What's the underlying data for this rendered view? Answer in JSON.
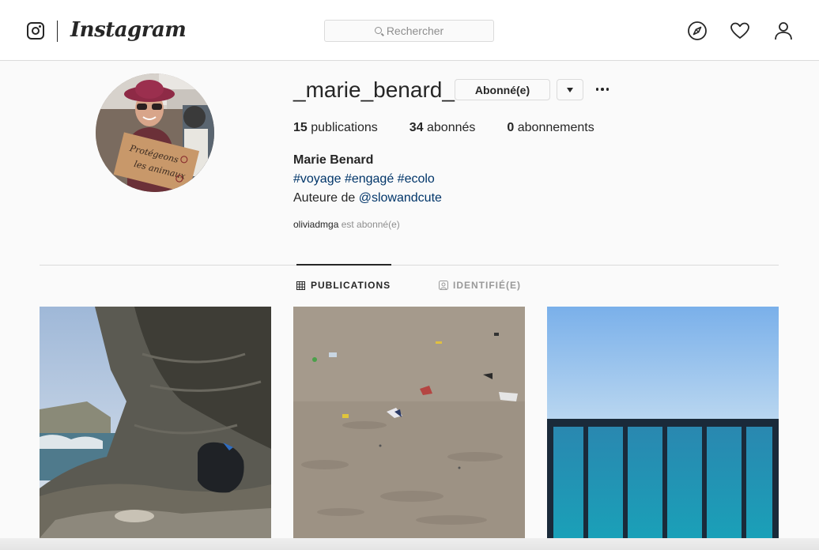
{
  "nav": {
    "wordmark": "Instagram",
    "search_placeholder": "Rechercher",
    "icons": [
      "instagram-glyph-icon",
      "search-icon",
      "compass-icon",
      "heart-icon",
      "profile-icon"
    ]
  },
  "profile": {
    "username": "_marie_benard_",
    "follow_button": "Abonné(e)",
    "stats": {
      "posts_count": "15",
      "posts_label": "publications",
      "followers_count": "34",
      "followers_label": "abonnés",
      "following_count": "0",
      "following_label": "abonnements"
    },
    "full_name": "Marie Benard",
    "bio_hashtags": "#voyage #engagé #ecolo",
    "bio_prefix": "Auteure de",
    "bio_mention": "@slowandcute",
    "followed_by_user": "oliviadmga",
    "followed_by_suffix": "est abonné(e)",
    "avatar_sign_text": "Protégeons les animaux"
  },
  "tabs": [
    {
      "label": "PUBLICATIONS",
      "active": true
    },
    {
      "label": "IDENTIFIÉ(E)",
      "active": false
    }
  ],
  "colors": {
    "link": "#003569",
    "border": "#dbdbdb",
    "muted": "#8e8e8e",
    "text": "#262626"
  }
}
